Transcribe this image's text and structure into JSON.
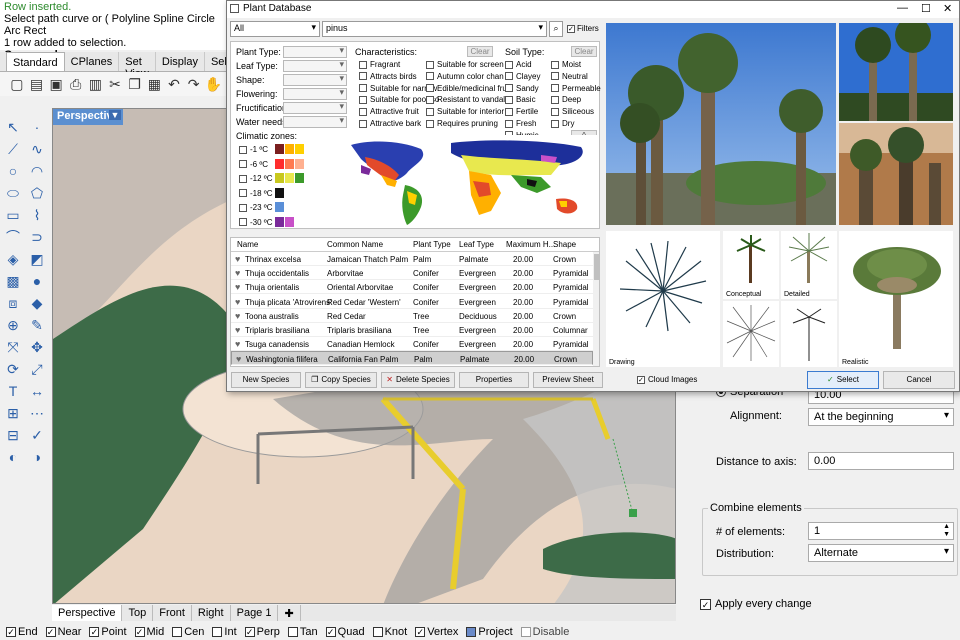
{
  "command": {
    "line1": "Row inserted.",
    "line2": "Select path curve or ( Polyline Spline Circle Arc Rect",
    "line3": "1 row added to selection.",
    "label": "Command:"
  },
  "toolbar_tabs": [
    "Standard",
    "CPlanes",
    "Set View",
    "Display",
    "Sele"
  ],
  "viewport": {
    "title": "Perspective",
    "tabs": [
      "Perspective",
      "Top",
      "Front",
      "Right",
      "Page 1"
    ],
    "add_tab": "✚"
  },
  "osnap": [
    {
      "label": "End",
      "checked": true
    },
    {
      "label": "Near",
      "checked": true
    },
    {
      "label": "Point",
      "checked": true
    },
    {
      "label": "Mid",
      "checked": true
    },
    {
      "label": "Cen",
      "checked": false
    },
    {
      "label": "Int",
      "checked": false
    },
    {
      "label": "Perp",
      "checked": true
    },
    {
      "label": "Tan",
      "checked": false
    },
    {
      "label": "Quad",
      "checked": true
    },
    {
      "label": "Knot",
      "checked": false
    },
    {
      "label": "Vertex",
      "checked": true
    },
    {
      "label": "Project",
      "checked": false
    },
    {
      "label": "Disable",
      "checked": false
    }
  ],
  "right_panel": {
    "separation_label": "Separation",
    "separation_value": "10.00",
    "alignment_label": "Alignment:",
    "alignment_value": "At the beginning",
    "distance_label": "Distance to axis:",
    "distance_value": "0.00",
    "combine_title": "Combine elements",
    "num_label": "# of elements:",
    "num_value": "1",
    "distribution_label": "Distribution:",
    "distribution_value": "Alternate",
    "apply_label": "Apply every change"
  },
  "plant_db": {
    "title": "Plant Database",
    "category": "All",
    "search": "pinus",
    "filters_label": "Filters",
    "filter_labels": [
      "Plant Type:",
      "Leaf Type:",
      "Shape:",
      "Flowering:",
      "Fructification:",
      "Water needs:"
    ],
    "characteristics_label": "Characteristics:",
    "clear_label": "Clear",
    "soil_label": "Soil Type:",
    "char_col1": [
      "Fragrant",
      "Attracts birds",
      "Suitable for narrow",
      "Suitable for poor so",
      "Attractive fruit",
      "Attractive bark"
    ],
    "char_col2": [
      "Suitable for screen",
      "Autumn color chan",
      "Edible/medicinal fru",
      "Resistant to vandali",
      "Suitable for interior",
      "Requires pruning"
    ],
    "soil_col1": [
      "Acid",
      "Clayey",
      "Sandy",
      "Basic",
      "Fertile",
      "Fresh",
      "Humic"
    ],
    "soil_col2": [
      "Moist",
      "Neutral",
      "Permeable",
      "Deep",
      "Siliceous",
      "Dry"
    ],
    "climate_label": "Climatic zones:",
    "zones": [
      {
        "label": "-1 ºC",
        "colors": [
          "#7a1f1f",
          "#ffb000",
          "#ffd000"
        ]
      },
      {
        "label": "-6 ºC",
        "colors": [
          "#ff2d2d",
          "#ff7a50",
          "#ffb090"
        ]
      },
      {
        "label": "-12 ºC",
        "colors": [
          "#c8c81e",
          "#e8e84e",
          "#3c9a2a"
        ]
      },
      {
        "label": "-18 ºC",
        "colors": [
          "#111111"
        ]
      },
      {
        "label": "-23 ºC",
        "colors": [
          "#5a8fd8"
        ]
      },
      {
        "label": "-30 ºC",
        "colors": [
          "#7a2a9a",
          "#c850c8"
        ]
      }
    ],
    "columns": [
      "Name",
      "Common Name",
      "Plant Type",
      "Leaf Type",
      "Maximum H...",
      "Shape"
    ],
    "rows": [
      {
        "name": "Thrinax excelsa",
        "common": "Jamaican Thatch Palm",
        "type": "Palm",
        "leaf": "Palmate",
        "height": "20.00",
        "shape": "Crown"
      },
      {
        "name": "Thuja occidentalis",
        "common": "Arborvitae",
        "type": "Conifer",
        "leaf": "Evergreen",
        "height": "20.00",
        "shape": "Pyramidal"
      },
      {
        "name": "Thuja orientalis",
        "common": "Oriental Arborvitae",
        "type": "Conifer",
        "leaf": "Evergreen",
        "height": "20.00",
        "shape": "Pyramidal"
      },
      {
        "name": "Thuja plicata 'Atrovirens'",
        "common": "Red Cedar 'Western'",
        "type": "Conifer",
        "leaf": "Evergreen",
        "height": "20.00",
        "shape": "Pyramidal"
      },
      {
        "name": "Toona australis",
        "common": "Red Cedar",
        "type": "Tree",
        "leaf": "Deciduous",
        "height": "20.00",
        "shape": "Crown"
      },
      {
        "name": "Triplaris brasiliana",
        "common": "Triplaris brasiliana",
        "type": "Tree",
        "leaf": "Evergreen",
        "height": "20.00",
        "shape": "Columnar"
      },
      {
        "name": "Tsuga canadensis",
        "common": "Canadian Hemlock",
        "type": "Conifer",
        "leaf": "Evergreen",
        "height": "20.00",
        "shape": "Pyramidal"
      },
      {
        "name": "Washingtonia filifera",
        "common": "California Fan Palm",
        "type": "Palm",
        "leaf": "Palmate",
        "height": "20.00",
        "shape": "Crown"
      }
    ],
    "buttons": {
      "new": "New Species",
      "copy": "Copy Species",
      "delete": "Delete Species",
      "properties": "Properties",
      "preview": "Preview Sheet",
      "cloud": "Cloud Images",
      "select": "Select",
      "cancel": "Cancel"
    },
    "thumb_captions": {
      "drawing": "Drawing",
      "conceptual": "Conceptual",
      "detailed": "Detailed",
      "realistic": "Realistic"
    }
  }
}
